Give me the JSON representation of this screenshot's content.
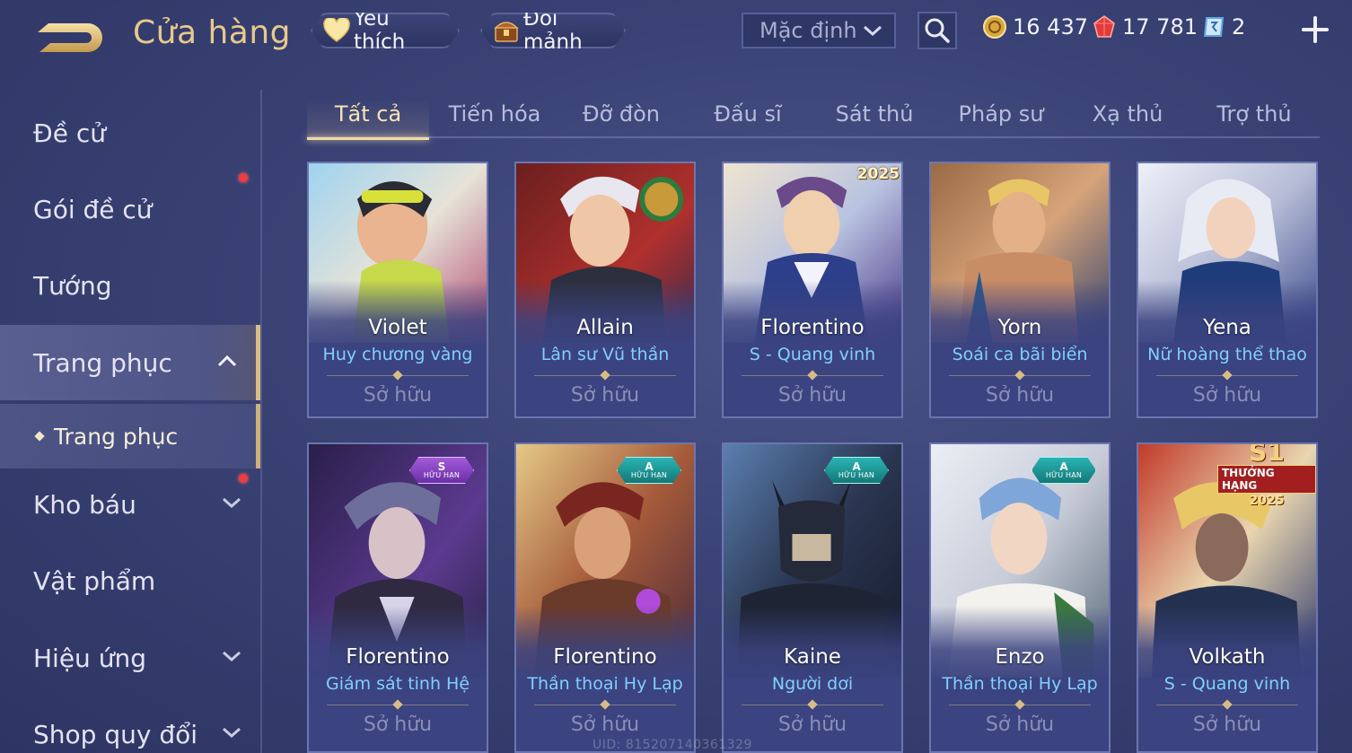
{
  "header": {
    "title": "Cửa hàng",
    "favorites_label": "Yêu thích",
    "shards_label": "Đổi mảnh",
    "sort_value": "Mặc định"
  },
  "currency": {
    "gold": "16 437",
    "ruby": "17 781",
    "voucher": "2"
  },
  "sidebar": {
    "items": [
      {
        "label": "Đề cử"
      },
      {
        "label": "Gói đề cử"
      },
      {
        "label": "Tướng"
      },
      {
        "label": "Trang phục"
      },
      {
        "label": "Trang phục"
      },
      {
        "label": "Kho báu"
      },
      {
        "label": "Vật phẩm"
      },
      {
        "label": "Hiệu ứng"
      },
      {
        "label": "Shop quy đổi"
      }
    ]
  },
  "tabs": [
    {
      "label": "Tất cả"
    },
    {
      "label": "Tiến hóa"
    },
    {
      "label": "Đỡ đòn"
    },
    {
      "label": "Đấu sĩ"
    },
    {
      "label": "Sát thủ"
    },
    {
      "label": "Pháp sư"
    },
    {
      "label": "Xạ thủ"
    },
    {
      "label": "Trợ thủ"
    }
  ],
  "cards": [
    {
      "hero": "Violet",
      "skin": "Huy chương vàng",
      "status": "Sở hữu"
    },
    {
      "hero": "Allain",
      "skin": "Lân sư Vũ thần",
      "status": "Sở hữu"
    },
    {
      "hero": "Florentino",
      "skin": "S - Quang vinh",
      "status": "Sở hữu",
      "tag": "2025"
    },
    {
      "hero": "Yorn",
      "skin": "Soái ca bãi biển",
      "status": "Sở hữu"
    },
    {
      "hero": "Yena",
      "skin": "Nữ hoàng thể thao",
      "status": "Sở hữu"
    },
    {
      "hero": "Florentino",
      "skin": "Giám sát tinh Hệ",
      "status": "Sở hữu",
      "badge_grade": "S",
      "badge_text": "HỮU HẠN"
    },
    {
      "hero": "Florentino",
      "skin": "Thần thoại Hy Lạp",
      "status": "Sở hữu",
      "badge_grade": "A",
      "badge_text": "HỮU HẠN"
    },
    {
      "hero": "Kaine",
      "skin": "Người dơi",
      "status": "Sở hữu",
      "badge_grade": "A",
      "badge_text": "HỮU HẠN"
    },
    {
      "hero": "Enzo",
      "skin": "Thần thoại Hy Lạp",
      "status": "Sở hữu",
      "badge_grade": "A",
      "badge_text": "HỮU HẠN"
    },
    {
      "hero": "Volkath",
      "skin": "S - Quang vinh",
      "status": "Sở hữu",
      "rank_badge": "S1",
      "rank_label": "THƯỞNG HẠNG",
      "rank_year": "2025"
    }
  ],
  "footer": {
    "uid": "UID: 815207140361329"
  },
  "colors": {
    "accent_gold": "#e7c98b",
    "skin_name_blue": "#7fd0ff",
    "notification_red": "#f03c3c",
    "badge_s": "#8a44c4",
    "badge_a": "#1e9a9a"
  },
  "icons": {
    "back": "back-arrow-icon",
    "favorites": "heart-icon",
    "shards": "treasure-chest-icon",
    "sort": "chevron-down-icon",
    "search": "search-icon",
    "gold": "gold-coin-icon",
    "ruby": "ruby-gem-icon",
    "voucher": "voucher-icon",
    "plus": "plus-icon"
  }
}
